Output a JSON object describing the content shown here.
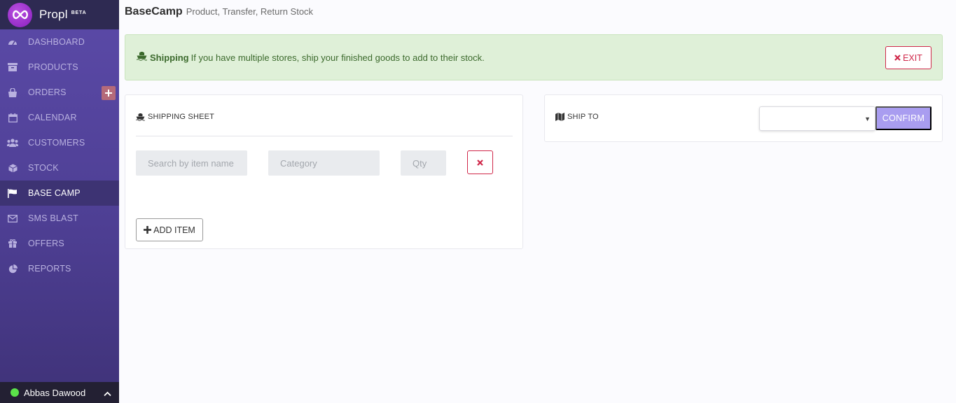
{
  "brand": {
    "name": "Propl",
    "badge": "BETA"
  },
  "sidebar": {
    "items": [
      {
        "label": "DASHBOARD",
        "icon": "dashboard-icon"
      },
      {
        "label": "PRODUCTS",
        "icon": "archive-icon"
      },
      {
        "label": "ORDERS",
        "icon": "shopping-bag-icon"
      },
      {
        "label": "CALENDAR",
        "icon": "calendar-icon"
      },
      {
        "label": "CUSTOMERS",
        "icon": "users-icon"
      },
      {
        "label": "STOCK",
        "icon": "cube-icon"
      },
      {
        "label": "BASE CAMP",
        "icon": "flag-icon",
        "active": true
      },
      {
        "label": "SMS BLAST",
        "icon": "envelope-icon"
      },
      {
        "label": "OFFERS",
        "icon": "gift-icon"
      },
      {
        "label": "REPORTS",
        "icon": "pie-chart-icon"
      }
    ]
  },
  "user": {
    "name": "Abbas Dawood",
    "status_color": "#5be34a"
  },
  "header": {
    "title": "BaseCamp",
    "subtitle": "Product, Transfer, Return Stock"
  },
  "alert": {
    "title": "Shipping",
    "message": "If you have multiple stores, ship your finished goods to add to their stock.",
    "exit_label": "EXIT"
  },
  "shipping_sheet": {
    "heading": "SHIPPING SHEET",
    "item_placeholder": "Search by item name",
    "category_placeholder": "Category",
    "qty_placeholder": "Qty",
    "add_label": "ADD ITEM"
  },
  "ship_to": {
    "heading": "SHIP TO",
    "selected": "",
    "confirm_label": "CONFIRM"
  },
  "colors": {
    "sidebar": "#4e3f94",
    "accent_danger": "#d0284a",
    "confirm": "#a99df0",
    "alert_bg": "#dff0d8"
  }
}
